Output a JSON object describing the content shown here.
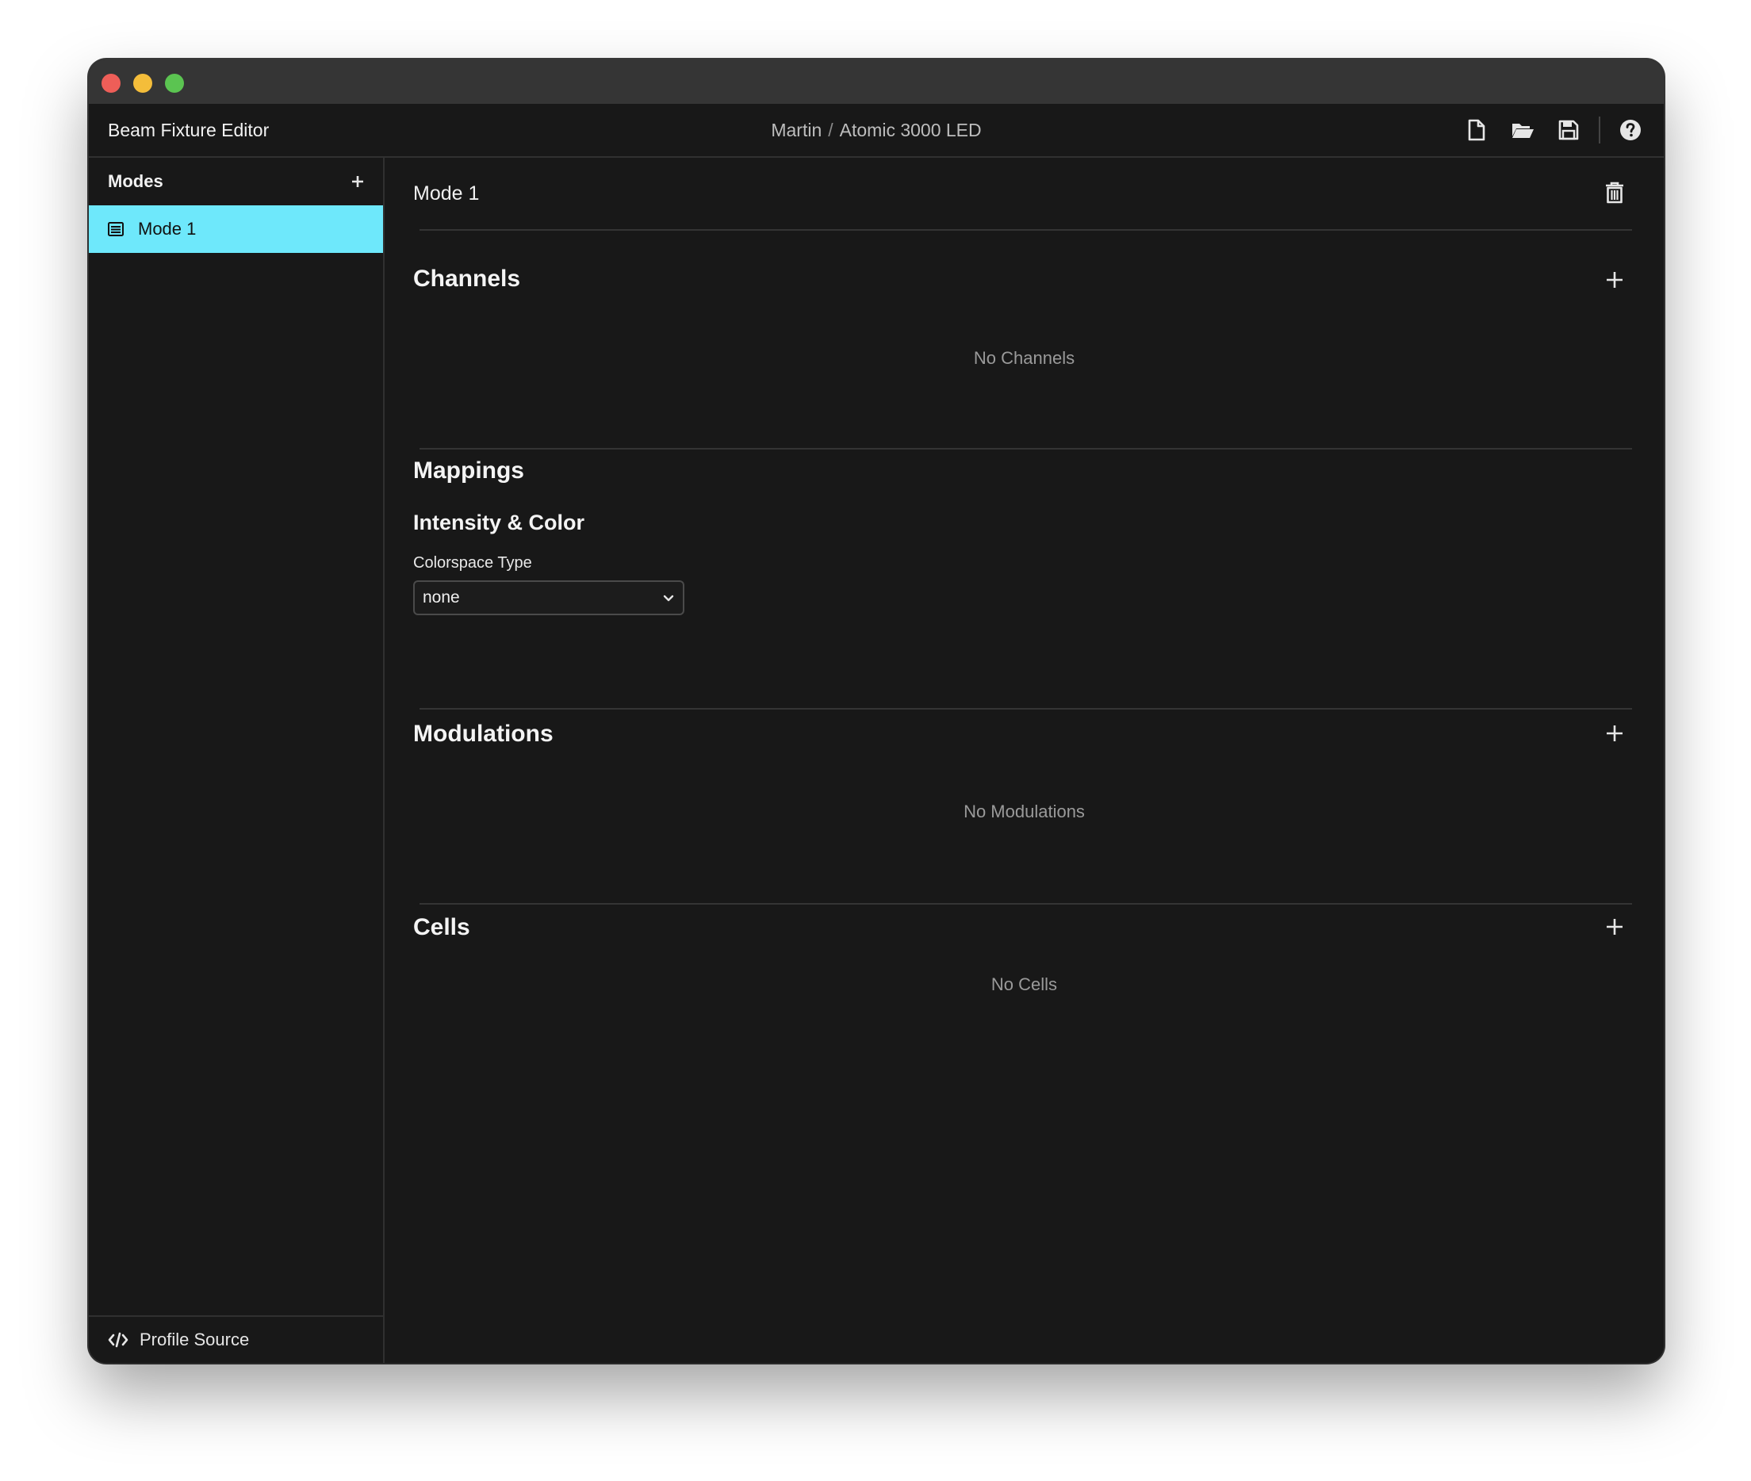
{
  "app": {
    "title": "Beam Fixture Editor"
  },
  "document": {
    "manufacturer": "Martin",
    "separator": "/",
    "model": "Atomic 3000 LED"
  },
  "toolbar": {
    "icons": [
      "new-file-icon",
      "open-folder-icon",
      "save-icon",
      "help-icon"
    ]
  },
  "sidebar": {
    "header": "Modes",
    "modes": [
      {
        "label": "Mode 1",
        "selected": true
      }
    ],
    "footer": "Profile Source",
    "selected_color": "#6ee8fb"
  },
  "main": {
    "mode_name": "Mode 1",
    "channels": {
      "title": "Channels",
      "empty": "No Channels"
    },
    "mappings": {
      "title": "Mappings",
      "intensity_color": {
        "title": "Intensity & Color",
        "colorspace_label": "Colorspace Type",
        "colorspace_value": "none"
      }
    },
    "modulations": {
      "title": "Modulations",
      "empty": "No Modulations"
    },
    "cells": {
      "title": "Cells",
      "empty": "No Cells"
    }
  }
}
